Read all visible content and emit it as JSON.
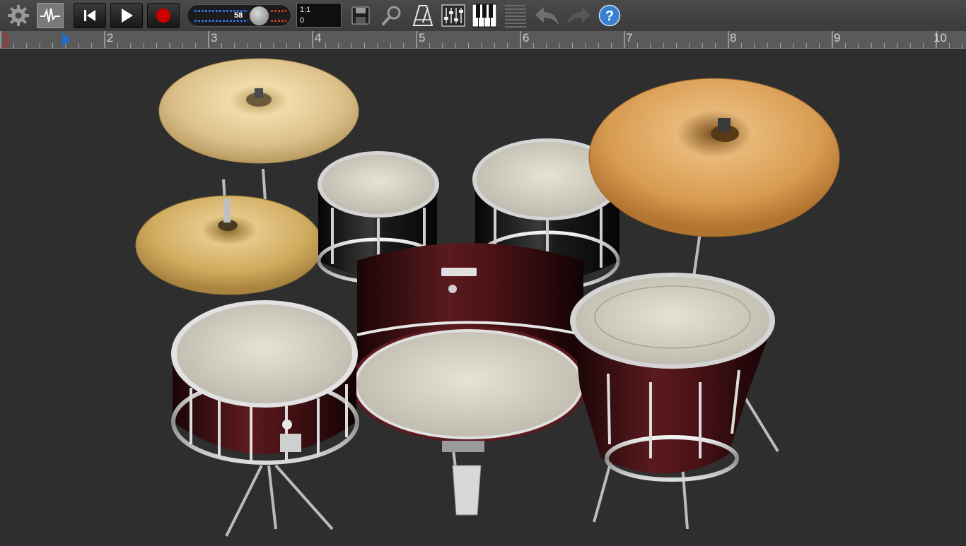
{
  "toolbar": {
    "tempo_value": "58",
    "position_line1": "1:1",
    "position_line2": "0"
  },
  "ruler": {
    "labels": [
      "2",
      "3",
      "4",
      "5",
      "6",
      "7",
      "8",
      "9",
      "10"
    ]
  },
  "icons": {
    "settings": "gear-icon",
    "waveform": "waveform-icon",
    "rewind": "skip-back-icon",
    "play": "play-icon",
    "record": "record-icon",
    "save": "floppy-disk-icon",
    "zoom": "magnifier-icon",
    "metronome": "metronome-icon",
    "mixer": "mixer-icon",
    "keyboard": "piano-keys-icon",
    "tracks": "tracks-list-icon",
    "undo": "undo-icon",
    "redo": "redo-icon",
    "help": "help-icon"
  },
  "colors": {
    "background": "#2e2e2e",
    "toolbar": "#404040",
    "record": "#cc0000",
    "help": "#3a7fd0",
    "ruler": "#5a5a5a",
    "cymbal_gold": "#d9b25e",
    "drum_shell": "#3a0f12",
    "drum_head": "#cfcbc0"
  },
  "drum_kit": {
    "pieces": [
      "crash-cymbal",
      "hi-hat",
      "ride-cymbal",
      "tom-1",
      "tom-2",
      "snare-drum",
      "bass-drum",
      "floor-tom",
      "kick-pedal"
    ]
  }
}
